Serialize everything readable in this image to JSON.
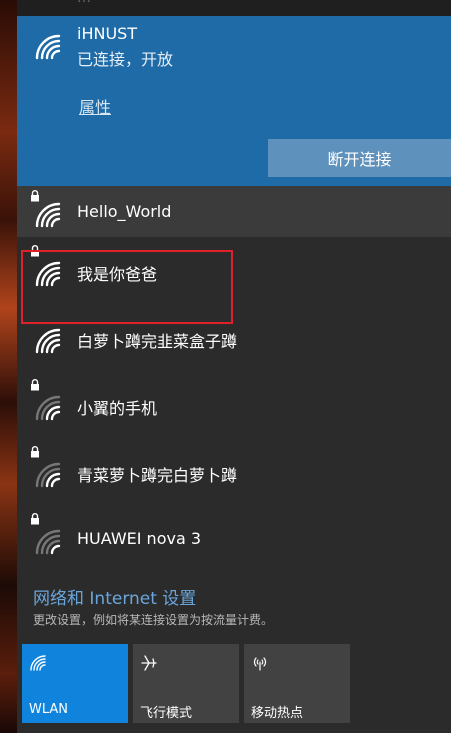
{
  "header": {
    "cut_text": "…"
  },
  "connected_network": {
    "name": "iHNUST",
    "status": "已连接，开放",
    "properties_link": "属性",
    "disconnect_button": "断开连接"
  },
  "networks": [
    {
      "name": "Hello_World",
      "icon": "wifi-icon",
      "secured": true,
      "highlighted": false
    },
    {
      "name": "我是你爸爸",
      "icon": "wifi-icon",
      "secured": true,
      "highlighted": true
    },
    {
      "name": "白萝卜蹲完韭菜盒子蹲",
      "icon": "wifi-icon",
      "secured": false,
      "highlighted": false
    },
    {
      "name": "小翼的手机",
      "icon": "wifi-icon",
      "secured": true,
      "highlighted": false
    },
    {
      "name": "青菜萝卜蹲完白萝卜蹲",
      "icon": "wifi-icon",
      "secured": true,
      "highlighted": false
    },
    {
      "name": "HUAWEI nova 3",
      "icon": "wifi-icon",
      "secured": true,
      "highlighted": false
    }
  ],
  "settings": {
    "title": "网络和 Internet 设置",
    "description": "更改设置，例如将某连接设置为按流量计费。"
  },
  "quick_actions": [
    {
      "label": "WLAN",
      "icon": "wifi-icon",
      "active": true
    },
    {
      "label": "飞行模式",
      "icon": "airplane-icon",
      "active": false
    },
    {
      "label": "移动热点",
      "icon": "hotspot-icon",
      "active": false
    }
  ],
  "colors": {
    "accent": "#1e6ba8",
    "tile_active": "#1083dc",
    "highlight_box": "#e0202a",
    "link": "#6aa6dc"
  }
}
